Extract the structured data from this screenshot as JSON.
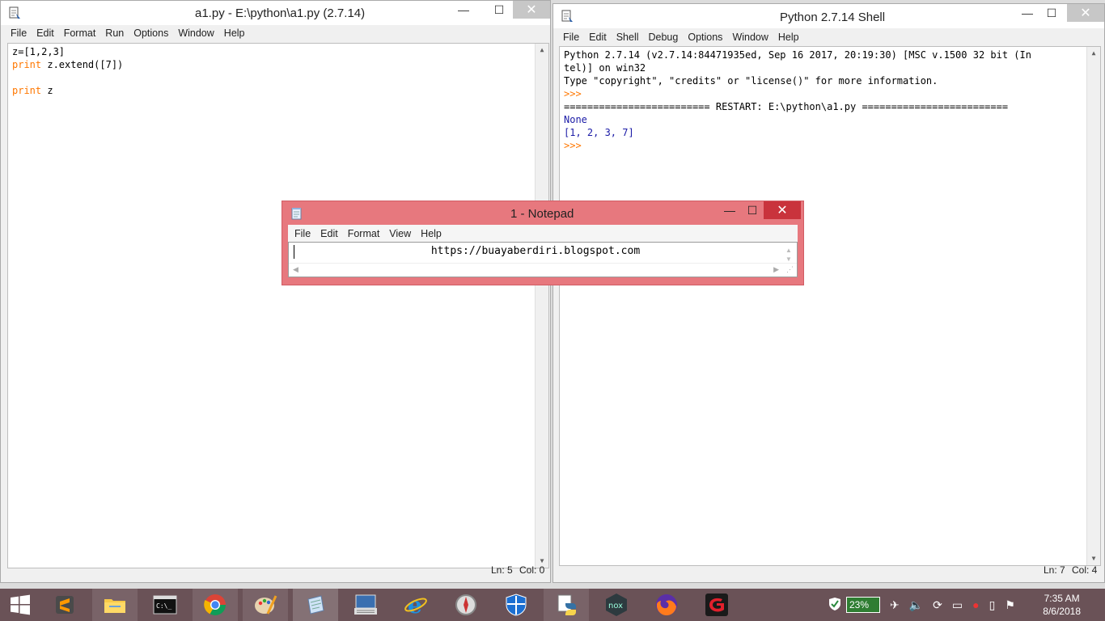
{
  "idle_editor": {
    "title": "a1.py - E:\\python\\a1.py (2.7.14)",
    "menu": [
      "File",
      "Edit",
      "Format",
      "Run",
      "Options",
      "Window",
      "Help"
    ],
    "code": [
      {
        "kw": "",
        "text": "z=[1,2,3]"
      },
      {
        "kw": "print",
        "text": " z.extend([7])"
      },
      {
        "kw": "",
        "text": ""
      },
      {
        "kw": "print",
        "text": " z"
      }
    ],
    "status_ln": "Ln: 5",
    "status_col": "Col: 0"
  },
  "shell": {
    "title": "Python 2.7.14 Shell",
    "menu": [
      "File",
      "Edit",
      "Shell",
      "Debug",
      "Options",
      "Window",
      "Help"
    ],
    "lines": [
      {
        "cls": "",
        "text": "Python 2.7.14 (v2.7.14:84471935ed, Sep 16 2017, 20:19:30) [MSC v.1500 32 bit (In"
      },
      {
        "cls": "",
        "text": "tel)] on win32"
      },
      {
        "cls": "",
        "text": "Type \"copyright\", \"credits\" or \"license()\" for more information."
      },
      {
        "cls": "prompt",
        "text": ">>> "
      },
      {
        "cls": "",
        "text": "========================= RESTART: E:\\python\\a1.py ========================="
      },
      {
        "cls": "out",
        "text": "None"
      },
      {
        "cls": "out",
        "text": "[1, 2, 3, 7]"
      },
      {
        "cls": "prompt",
        "text": ">>> "
      }
    ],
    "status_ln": "Ln: 7",
    "status_col": "Col: 4"
  },
  "notepad": {
    "title": "1 - Notepad",
    "menu": [
      "File",
      "Edit",
      "Format",
      "View",
      "Help"
    ],
    "text": "https://buayaberdiri.blogspot.com",
    "close_color": "#c9333c",
    "frame_color": "#e7787e"
  },
  "taskbar": {
    "apps": [
      "sublime-text-icon",
      "file-explorer-icon",
      "command-prompt-icon",
      "chrome-icon",
      "paint-icon",
      "notepad-icon",
      "on-screen-keyboard-icon",
      "internet-explorer-icon",
      "compass-icon",
      "windows-defender-icon",
      "python-idle-icon",
      "nox-player-icon",
      "firefox-icon",
      "garena-icon"
    ],
    "nox_label": "nox",
    "battery": "23%",
    "time": "7:35 AM",
    "date": "8/6/2018",
    "color": "#6a5257"
  }
}
